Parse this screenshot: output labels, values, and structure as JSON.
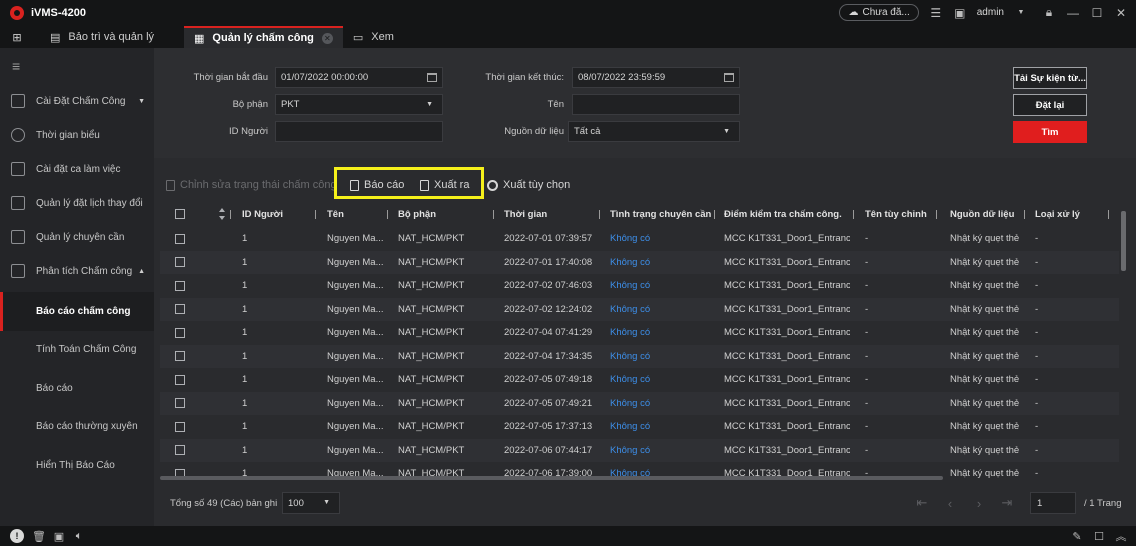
{
  "app": {
    "title": "iVMS-4200"
  },
  "header": {
    "cloud_status": "Chưa đă...",
    "user": "admin"
  },
  "tabs": [
    {
      "label": "Bảo trì và quản lý",
      "icon": "maintenance-icon"
    },
    {
      "label": "Quản lý chấm công",
      "icon": "calendar-icon",
      "active": true
    },
    {
      "label": "Xem",
      "icon": "monitor-icon"
    }
  ],
  "sidebar": {
    "items": [
      {
        "label": "Cài Đặt Chấm Công",
        "icon": "calendar-icon",
        "expandable": true
      },
      {
        "label": "Thời gian biểu",
        "icon": "clock-icon"
      },
      {
        "label": "Cài đặt ca làm việc",
        "icon": "shift-icon"
      },
      {
        "label": "Quản lý đặt lịch thay đổi",
        "icon": "schedule-icon"
      },
      {
        "label": "Quản lý chuyên cần",
        "icon": "check-icon"
      },
      {
        "label": "Phân tích Chấm công",
        "icon": "chart-icon",
        "expandable": true,
        "expanded": true
      }
    ],
    "subitems": [
      {
        "label": "Báo cáo chấm công",
        "active": true
      },
      {
        "label": "Tính Toán Chấm Công"
      },
      {
        "label": "Báo cáo"
      },
      {
        "label": "Báo cáo thường xuyên"
      },
      {
        "label": "Hiển Thị Báo Cáo"
      }
    ]
  },
  "filters": {
    "start_time_label": "Thời gian bắt đầu",
    "start_time": "01/07/2022 00:00:00",
    "end_time_label": "Thời gian kết thúc:",
    "end_time": "08/07/2022 23:59:59",
    "department_label": "Bộ phận",
    "department": "PKT",
    "name_label": "Tên",
    "name": "",
    "person_id_label": "ID Người",
    "person_id": "",
    "source_label": "Nguồn dữ liệu",
    "source": "Tất cả",
    "btn_load": "Tải Sự kiện từ...",
    "btn_reset": "Đặt lại",
    "btn_search": "Tìm"
  },
  "toolbar": {
    "edit_status": "Chỉnh sửa trạng thái chấm công",
    "report": "Báo cáo",
    "export": "Xuất ra",
    "export_custom": "Xuất tùy chọn",
    "highlight_color": "#f5f01b"
  },
  "table": {
    "columns": [
      "ID Người",
      "Tên",
      "Bộ phận",
      "Thời gian",
      "Tình trạng chuyên cần",
      "Điểm kiểm tra chấm công.",
      "Tên tùy chỉnh",
      "Nguồn dữ liệu",
      "Loại xử lý"
    ],
    "rows": [
      [
        "1",
        "Nguyen Ma...",
        "NAT_HCM/PKT",
        "2022-07-01 07:39:57",
        "Không có",
        "MCC K1T331_Door1_Entranc...",
        "-",
        "Nhật ký quẹt thẻ",
        "-"
      ],
      [
        "1",
        "Nguyen Ma...",
        "NAT_HCM/PKT",
        "2022-07-01 17:40:08",
        "Không có",
        "MCC K1T331_Door1_Entranc...",
        "-",
        "Nhật ký quẹt thẻ",
        "-"
      ],
      [
        "1",
        "Nguyen Ma...",
        "NAT_HCM/PKT",
        "2022-07-02 07:46:03",
        "Không có",
        "MCC K1T331_Door1_Entranc...",
        "-",
        "Nhật ký quẹt thẻ",
        "-"
      ],
      [
        "1",
        "Nguyen Ma...",
        "NAT_HCM/PKT",
        "2022-07-02 12:24:02",
        "Không có",
        "MCC K1T331_Door1_Entranc...",
        "-",
        "Nhật ký quẹt thẻ",
        "-"
      ],
      [
        "1",
        "Nguyen Ma...",
        "NAT_HCM/PKT",
        "2022-07-04 07:41:29",
        "Không có",
        "MCC K1T331_Door1_Entranc...",
        "-",
        "Nhật ký quẹt thẻ",
        "-"
      ],
      [
        "1",
        "Nguyen Ma...",
        "NAT_HCM/PKT",
        "2022-07-04 17:34:35",
        "Không có",
        "MCC K1T331_Door1_Entranc...",
        "-",
        "Nhật ký quẹt thẻ",
        "-"
      ],
      [
        "1",
        "Nguyen Ma...",
        "NAT_HCM/PKT",
        "2022-07-05 07:49:18",
        "Không có",
        "MCC K1T331_Door1_Entranc...",
        "-",
        "Nhật ký quẹt thẻ",
        "-"
      ],
      [
        "1",
        "Nguyen Ma...",
        "NAT_HCM/PKT",
        "2022-07-05 07:49:21",
        "Không có",
        "MCC K1T331_Door1_Entranc...",
        "-",
        "Nhật ký quẹt thẻ",
        "-"
      ],
      [
        "1",
        "Nguyen Ma...",
        "NAT_HCM/PKT",
        "2022-07-05 17:37:13",
        "Không có",
        "MCC K1T331_Door1_Entranc...",
        "-",
        "Nhật ký quẹt thẻ",
        "-"
      ],
      [
        "1",
        "Nguyen Ma...",
        "NAT_HCM/PKT",
        "2022-07-06 07:44:17",
        "Không có",
        "MCC K1T331_Door1_Entranc...",
        "-",
        "Nhật ký quẹt thẻ",
        "-"
      ],
      [
        "1",
        "Nguyen Ma...",
        "NAT_HCM/PKT",
        "2022-07-06 17:39:00",
        "Không có",
        "MCC K1T331_Door1_Entranc...",
        "-",
        "Nhật ký quẹt thẻ",
        "-"
      ]
    ]
  },
  "pagination": {
    "total_text": "Tổng số 49 (Các) bản ghi",
    "page_size": "100",
    "current_page": "1",
    "total_pages": "/ 1 Trang"
  },
  "colors": {
    "accent": "#d9221f",
    "link": "#3d8ee8",
    "search_button": "#e01e1e"
  }
}
